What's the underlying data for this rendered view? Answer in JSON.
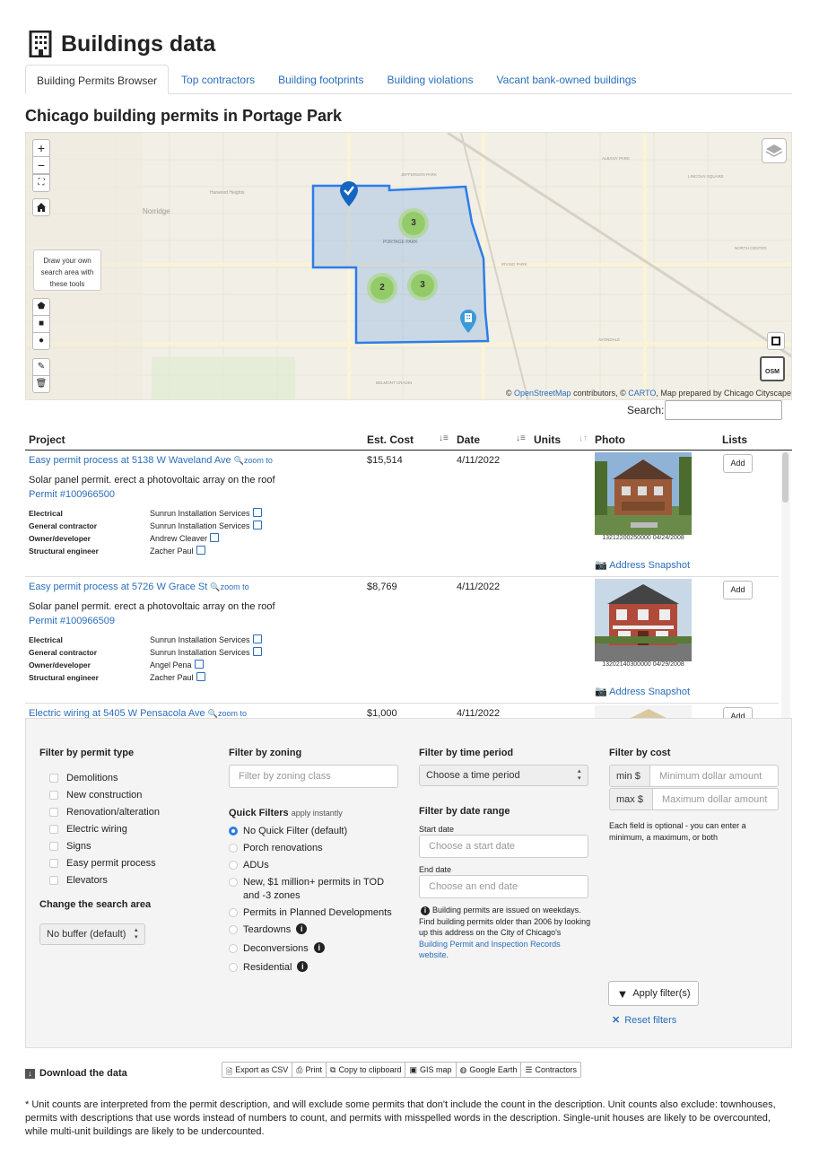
{
  "header": {
    "title": "Buildings data"
  },
  "tabs": [
    {
      "label": "Building Permits Browser",
      "active": true
    },
    {
      "label": "Top contractors"
    },
    {
      "label": "Building footprints"
    },
    {
      "label": "Building violations"
    },
    {
      "label": "Vacant bank-owned buildings"
    }
  ],
  "page_heading": "Chicago building permits in Portage Park",
  "map": {
    "zoom_in": "+",
    "zoom_out": "−",
    "draw_tip": "Draw your own search area with these tools",
    "clusters": [
      "3",
      "2",
      "3"
    ],
    "place_labels": [
      "Norridge",
      "Harwood Heights",
      "PORTAGE PARK",
      "IRVING PARK",
      "BELMONT CRAGIN",
      "JEFFERSON PARK",
      "ALBANY PARK",
      "AVONDALE",
      "NORTH CENTER",
      "LINCOLN SQUARE"
    ],
    "attribution": {
      "pre": "© ",
      "osm": "OpenStreetMap",
      "mid": " contributors, © ",
      "carto": "CARTO",
      "post": ", Map prepared by Chicago Cityscape"
    },
    "osm_label": "OSM"
  },
  "search": {
    "label": "Search:",
    "value": ""
  },
  "table": {
    "headers": {
      "project": "Project",
      "cost": "Est. Cost",
      "date": "Date",
      "units": "Units",
      "photo": "Photo",
      "lists": "Lists"
    },
    "rows": [
      {
        "project": "Easy permit process at 5138 W Waveland Ave",
        "zoom": "zoom to",
        "desc": "Solar panel permit. erect a photovoltaic array on the roof",
        "permit": "Permit #100966500",
        "roles": [
          {
            "role": "Electrical",
            "name": "Sunrun Installation Services"
          },
          {
            "role": "General contractor",
            "name": "Sunrun Installation Services"
          },
          {
            "role": "Owner/developer",
            "name": "Andrew Cleaver"
          },
          {
            "role": "Structural engineer",
            "name": "Zacher Paul"
          }
        ],
        "cost": "$15,514",
        "date": "4/11/2022",
        "units": "",
        "photo_caption": "13212200250000  04/24/2008",
        "snapshot": "Address Snapshot",
        "add": "Add"
      },
      {
        "project": "Easy permit process at 5726 W Grace St",
        "zoom": "zoom to",
        "desc": "Solar panel permit. erect a photovoltaic array on the roof",
        "permit": "Permit #100966509",
        "roles": [
          {
            "role": "Electrical",
            "name": "Sunrun Installation Services"
          },
          {
            "role": "General contractor",
            "name": "Sunrun Installation Services"
          },
          {
            "role": "Owner/developer",
            "name": "Angel Pena"
          },
          {
            "role": "Structural engineer",
            "name": "Zacher Paul"
          }
        ],
        "cost": "$8,769",
        "date": "4/11/2022",
        "units": "",
        "photo_caption": "13202140300000  04/29/2008",
        "snapshot": "Address Snapshot",
        "add": "Add"
      },
      {
        "project": "Electric wiring at 5405 W Pensacola Ave",
        "zoom": "zoom to",
        "cost": "$1,000",
        "date": "4/11/2022",
        "add": "Add"
      }
    ]
  },
  "filters": {
    "permit_type": {
      "heading": "Filter by permit type",
      "options": [
        "Demolitions",
        "New construction",
        "Renovation/alteration",
        "Electric wiring",
        "Signs",
        "Easy permit process",
        "Elevators"
      ]
    },
    "search_area": {
      "heading": "Change the search area",
      "selected": "No buffer (default)"
    },
    "zoning": {
      "heading": "Filter by zoning",
      "placeholder": "Filter by zoning class"
    },
    "quick": {
      "heading": "Quick Filters",
      "note": "apply instantly",
      "options": [
        {
          "label": "No Quick Filter (default)",
          "checked": true
        },
        {
          "label": "Porch renovations"
        },
        {
          "label": "ADUs"
        },
        {
          "label": "New, $1 million+ permits in TOD and -3 zones"
        },
        {
          "label": "Permits in Planned Developments"
        },
        {
          "label": "Teardowns",
          "info": true
        },
        {
          "label": "Deconversions",
          "info": true
        },
        {
          "label": "Residential",
          "info": true
        }
      ]
    },
    "time": {
      "heading": "Filter by time period",
      "selected": "Choose a time period"
    },
    "date_range": {
      "heading": "Filter by date range",
      "start_label": "Start date",
      "start_placeholder": "Choose a start date",
      "end_label": "End date",
      "end_placeholder": "Choose an end date",
      "note_pre": "Building permits are issued on weekdays. Find building permits older than 2006 by looking up this address on the City of Chicago's ",
      "note_link": "Building Permit and Inspection Records website",
      "note_post": "."
    },
    "cost": {
      "heading": "Filter by cost",
      "min_label": "min $",
      "min_placeholder": "Minimum dollar amount",
      "max_label": "max $",
      "max_placeholder": "Maximum dollar amount",
      "note": "Each field is optional - you can enter a minimum, a maximum, or both"
    },
    "apply": "Apply filter(s)",
    "reset": "Reset filters"
  },
  "download": {
    "label": "Download the data",
    "buttons": [
      "Export as CSV",
      "Print",
      "Copy to clipboard",
      "GIS map",
      "Google Earth",
      "Contractors"
    ]
  },
  "footnote": "* Unit counts are interpreted from the permit description, and will exclude some permits that don't include the count in the description. Unit counts also exclude: townhouses, permits with descriptions that use words instead of numbers to count, and permits with misspelled words in the description. Single-unit houses are likely to be overcounted, while multi-unit buildings are likely to be undercounted.",
  "colors": {
    "link": "#2a6ebb",
    "polygon": "#2b7de9",
    "cluster": "#8ac954",
    "map_bg": "#f2efe6"
  }
}
